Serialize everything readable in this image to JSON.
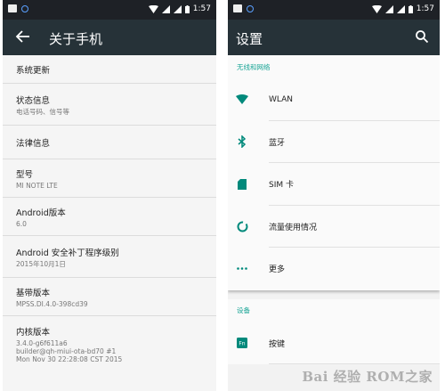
{
  "left_screen": {
    "status_bar": {
      "time": "1:57"
    },
    "toolbar": {
      "title": "关于手机"
    },
    "items": [
      {
        "title": "系统更新",
        "subtitle": ""
      },
      {
        "title": "状态信息",
        "subtitle": "电话号码、信号等"
      },
      {
        "title": "法律信息",
        "subtitle": ""
      },
      {
        "title": "型号",
        "subtitle": "MI NOTE LTE"
      },
      {
        "title": "Android版本",
        "subtitle": "6.0"
      },
      {
        "title": "Android 安全补丁程序级别",
        "subtitle": "2015年10月1日"
      },
      {
        "title": "基带版本",
        "subtitle": "MPSS.DI.4.0-398cd39"
      },
      {
        "title": "内核版本",
        "subtitle_lines": [
          "3.4.0-g6f611a6",
          "builder@qh-miui-ota-bd70 #1",
          "Mon Nov 30 22:28:08 CST 2015"
        ]
      }
    ]
  },
  "right_screen": {
    "status_bar": {
      "time": "1:57"
    },
    "toolbar": {
      "title": "设置"
    },
    "sections": {
      "wireless": "无线和网络",
      "device": "设备"
    },
    "wireless_items": [
      {
        "label": "WLAN",
        "icon": "wifi-icon"
      },
      {
        "label": "蓝牙",
        "icon": "bluetooth-icon"
      },
      {
        "label": "SIM 卡",
        "icon": "sim-card-icon"
      },
      {
        "label": "流量使用情况",
        "icon": "data-usage-icon"
      },
      {
        "label": "更多",
        "icon": "more-icon"
      }
    ],
    "device_items": [
      {
        "label": "按键",
        "icon": "buttons-icon"
      }
    ],
    "watermark": "Bai 经验 ROM之家"
  },
  "colors": {
    "toolbar": "#263238",
    "statusbar": "#1e2126",
    "accent": "#1aa596",
    "icon_teal": "#00897b"
  }
}
